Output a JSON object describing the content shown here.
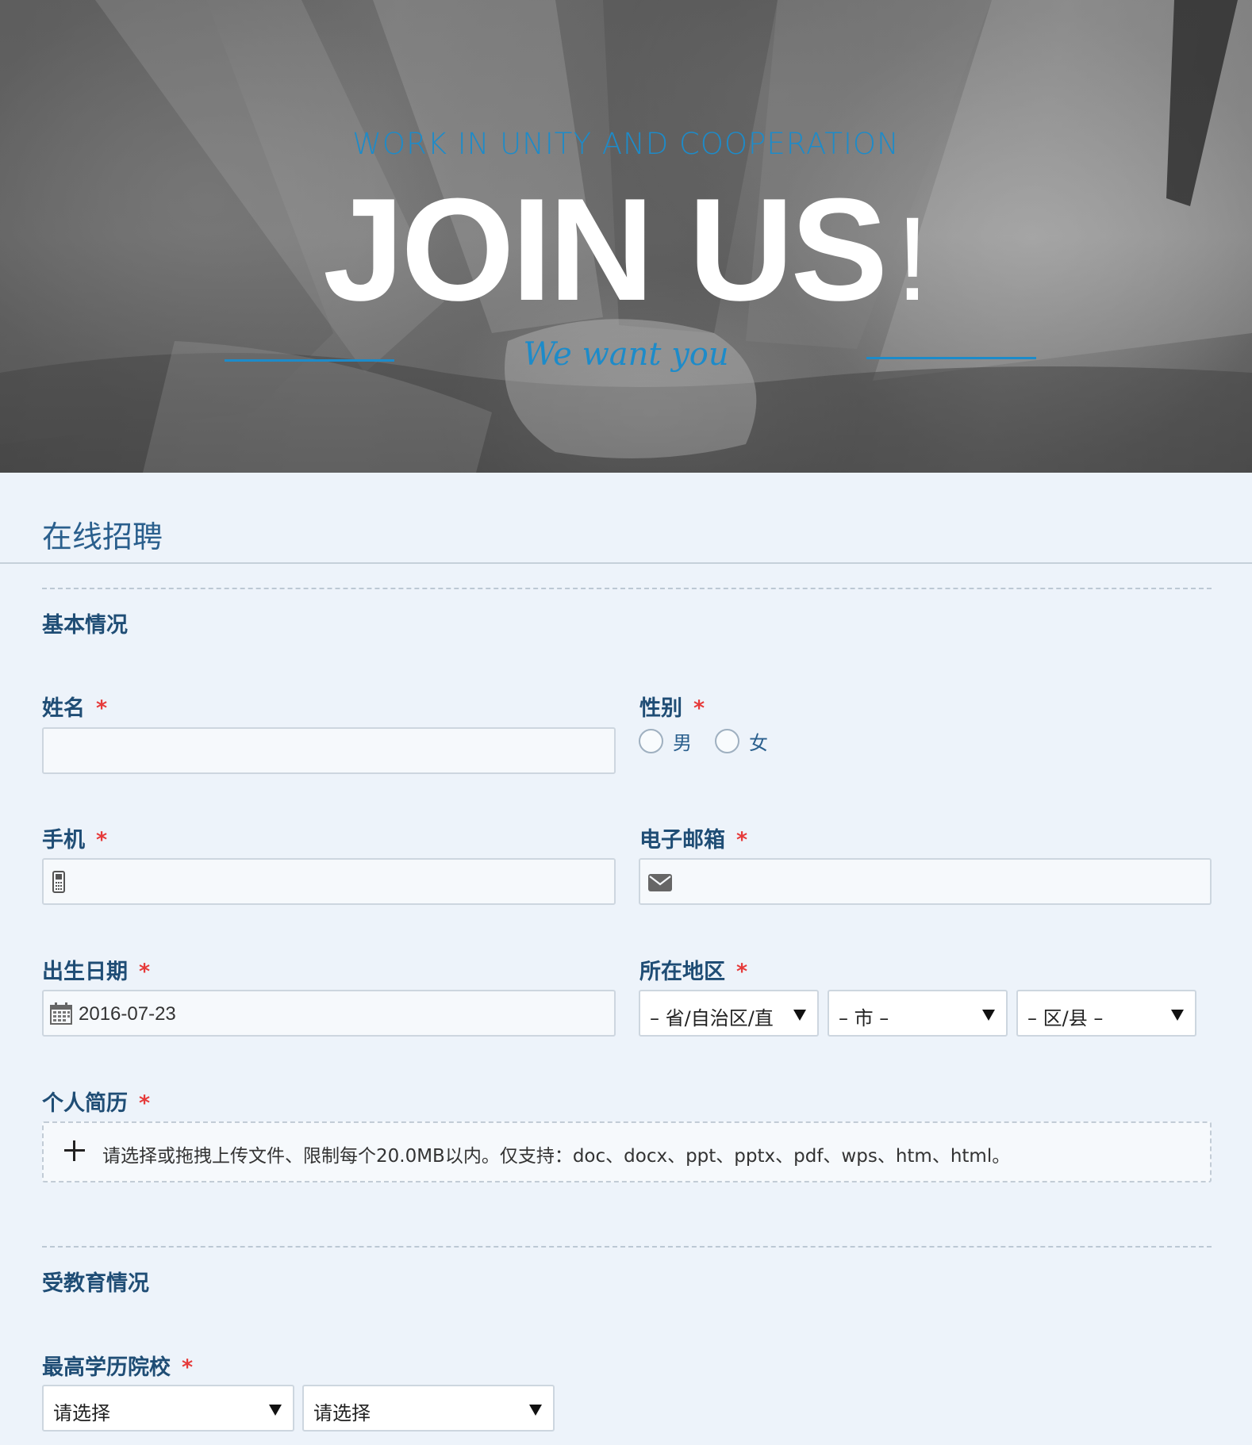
{
  "banner": {
    "tagline": "WORK IN UNITY AND COOPERATION",
    "headline": "JOIN US",
    "headline_mark": "!",
    "script": "We want you"
  },
  "page": {
    "title": "在线招聘"
  },
  "sections": {
    "basic": "基本情况",
    "education": "受教育情况"
  },
  "fields": {
    "name": {
      "label": "姓名",
      "required": "*",
      "value": ""
    },
    "gender": {
      "label": "性别",
      "required": "*",
      "options": [
        "男",
        "女"
      ]
    },
    "phone": {
      "label": "手机",
      "required": "*",
      "value": ""
    },
    "email": {
      "label": "电子邮箱",
      "required": "*",
      "value": ""
    },
    "birthdate": {
      "label": "出生日期",
      "required": "*",
      "value": "2016-07-23"
    },
    "region": {
      "label": "所在地区",
      "required": "*",
      "province": "– 省/自治区/直",
      "city": "– 市 –",
      "district": "– 区/县 –"
    },
    "resume": {
      "label": "个人简历",
      "required": "*",
      "hint": "请选择或拖拽上传文件、限制每个20.0MB以内。仅支持：doc、docx、ppt、pptx、pdf、wps、htm、html。"
    },
    "school": {
      "label": "最高学历院校",
      "required": "*",
      "select1": "请选择",
      "select2": "请选择"
    }
  },
  "colors": {
    "accent": "#1d8bc9",
    "required": "#e63a3a",
    "label": "#1f4d75",
    "background": "#edf3fa"
  },
  "icons": {
    "phone": "mobile-phone-icon",
    "email": "envelope-icon",
    "birthdate": "calendar-icon",
    "upload": "plus-icon",
    "select": "caret-down-icon"
  }
}
